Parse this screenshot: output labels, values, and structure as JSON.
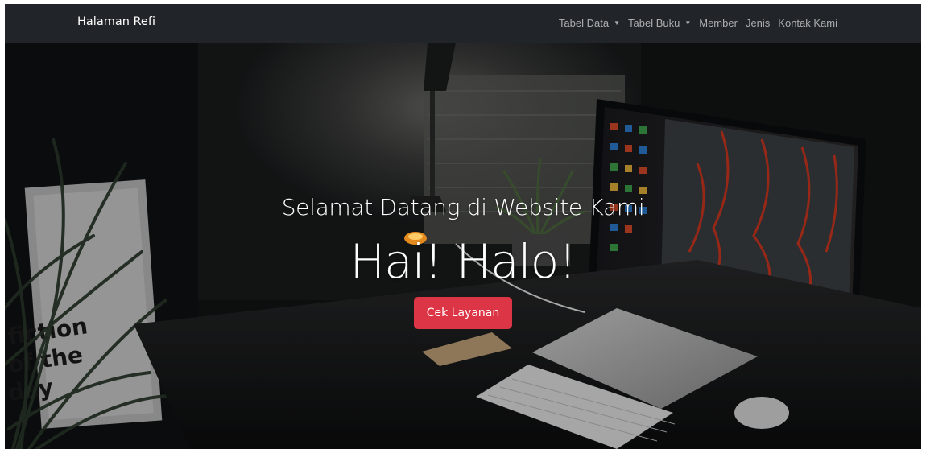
{
  "navbar": {
    "brand": "Halaman Refi",
    "items": [
      {
        "label": "Tabel Data",
        "dropdown": true
      },
      {
        "label": "Tabel Buku",
        "dropdown": true
      },
      {
        "label": "Member",
        "dropdown": false
      },
      {
        "label": "Jenis",
        "dropdown": false
      },
      {
        "label": "Kontak Kami",
        "dropdown": false
      }
    ]
  },
  "hero": {
    "subtitle": "Selamat Datang di Website Kami",
    "title": "Hai! Halo!",
    "button_label": "Cek Layanan",
    "poster_text": "fiction\nof the\nday"
  },
  "colors": {
    "navbar_bg": "#212529",
    "button_bg": "#dc3545",
    "hero_dark": "#121415",
    "lava": "#e2361c"
  },
  "icons": {
    "caret": "caret-down-icon"
  }
}
